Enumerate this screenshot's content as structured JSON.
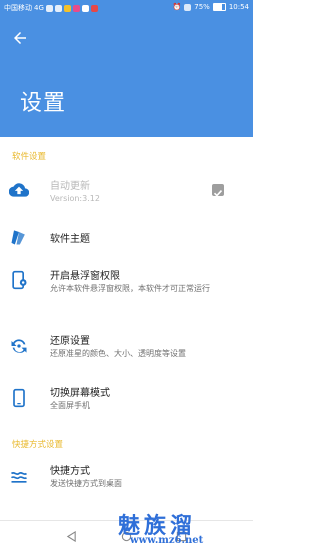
{
  "status_bar": {
    "carrier": "中国移动",
    "net": "4G",
    "battery": "75%",
    "time": "10:54"
  },
  "header": {
    "title": "设置"
  },
  "sections": {
    "software": "软件设置",
    "shortcut": "快捷方式设置"
  },
  "items": {
    "auto_update": {
      "title": "自动更新",
      "desc": "Version:3.12",
      "checked": true
    },
    "theme": {
      "title": "软件主题"
    },
    "float_window": {
      "title": "开启悬浮窗权限",
      "desc": "允许本软件悬浮窗权限，本软件才可正常运行"
    },
    "restore": {
      "title": "还原设置",
      "desc": "还原准星的颜色、大小、透明度等设置"
    },
    "screen_mode": {
      "title": "切换屏幕模式",
      "desc": "全面屏手机"
    },
    "shortcut": {
      "title": "快捷方式",
      "desc": "发送快捷方式到桌面"
    }
  },
  "watermark": {
    "text": "魅族溜",
    "url": "www.mz6.net"
  },
  "colors": {
    "header": "#4a90e2",
    "section": "#e9b92e",
    "icon": "#1f73c9"
  }
}
